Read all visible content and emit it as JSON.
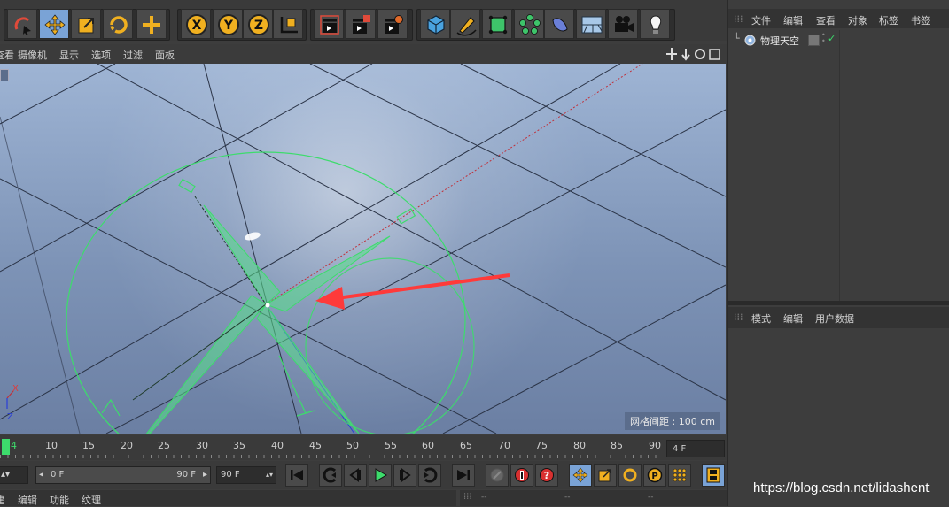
{
  "toolbar": {
    "buttons": [
      {
        "name": "live-selection-icon"
      },
      {
        "name": "move-tool-icon"
      },
      {
        "name": "scale-tool-icon"
      },
      {
        "name": "rotate-tool-icon"
      },
      {
        "name": "recent-tool-icon"
      },
      {
        "name": "x-axis-lock-icon",
        "label": "X"
      },
      {
        "name": "y-axis-lock-icon",
        "label": "Y"
      },
      {
        "name": "z-axis-lock-icon",
        "label": "Z"
      },
      {
        "name": "coordinate-system-icon"
      },
      {
        "name": "render-view-icon"
      },
      {
        "name": "render-picture-viewer-icon"
      },
      {
        "name": "render-settings-icon"
      },
      {
        "name": "cube-object-icon"
      },
      {
        "name": "pen-spline-icon"
      },
      {
        "name": "subdivision-surface-icon"
      },
      {
        "name": "cloner-icon"
      },
      {
        "name": "deformer-icon"
      },
      {
        "name": "floor-scene-icon"
      },
      {
        "name": "camera-icon"
      },
      {
        "name": "light-icon"
      }
    ]
  },
  "viewport": {
    "menu": [
      "查看",
      "摄像机",
      "显示",
      "选项",
      "过滤",
      "面板"
    ],
    "grid_label": "网格间距 : 100 cm",
    "axis": {
      "x": "X",
      "z": "Z"
    },
    "colors": {
      "grid": "#2b3447",
      "sky_object": "#3ddc6c",
      "arrow": "#ff3a3a",
      "x_axis": "#c0303a",
      "z_axis": "#2a3ed8"
    }
  },
  "timeline": {
    "ticks": [
      "4",
      "10",
      "15",
      "20",
      "25",
      "30",
      "35",
      "40",
      "45",
      "50",
      "55",
      "60",
      "65",
      "70",
      "75",
      "80",
      "85",
      "90"
    ],
    "current_frame": "4 F"
  },
  "transport": {
    "start_field": "0 F",
    "range_start": "0 F",
    "range_end": "90 F",
    "end_field": "90 F"
  },
  "bottom_menu": [
    "建",
    "编辑",
    "功能",
    "纹理"
  ],
  "bottom_right": [
    "--",
    "--",
    "--"
  ],
  "object_manager": {
    "menu": [
      "文件",
      "编辑",
      "查看",
      "对象",
      "标签",
      "书签"
    ],
    "object_name": "物理天空"
  },
  "attribute_manager": {
    "menu": [
      "模式",
      "编辑",
      "用户数据"
    ]
  },
  "watermark": "https://blog.csdn.net/lidashent"
}
